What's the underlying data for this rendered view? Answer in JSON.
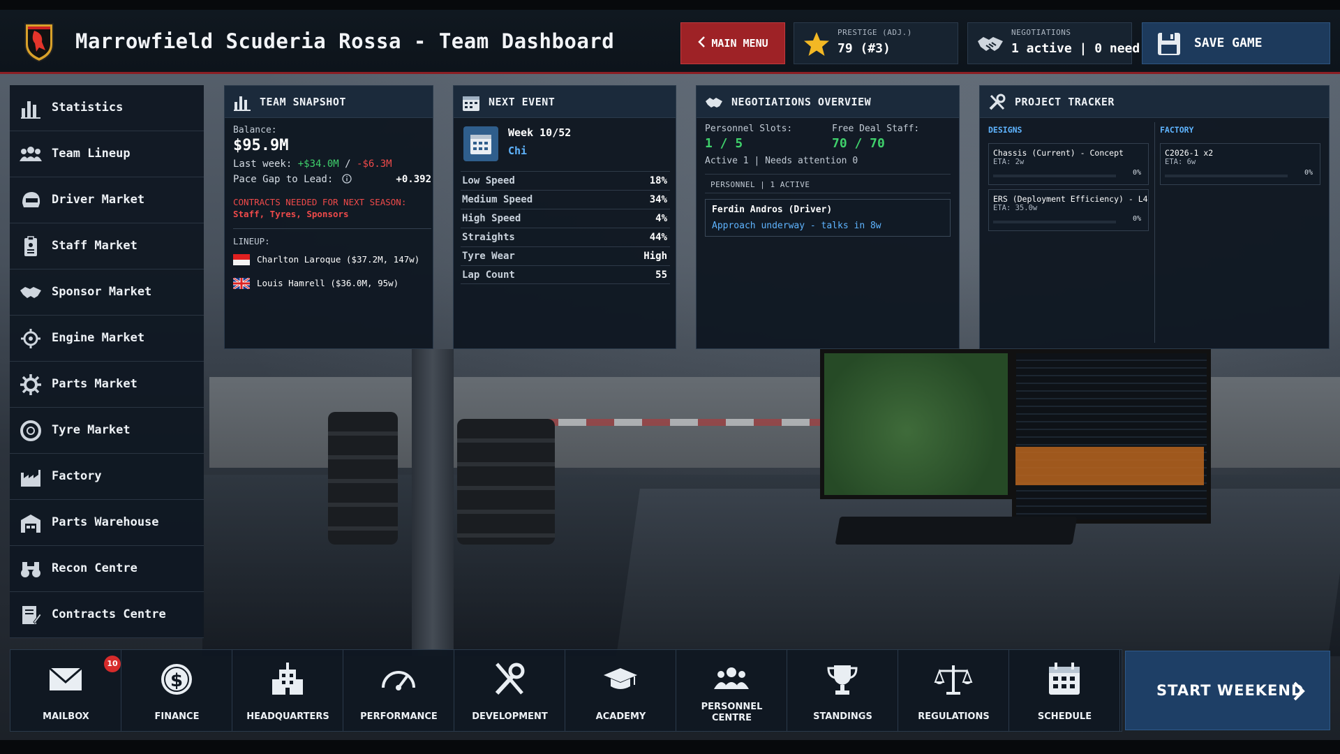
{
  "header": {
    "title": "Marrowfield Scuderia Rossa - Team Dashboard",
    "main_menu_label": "MAIN MENU",
    "prestige": {
      "label": "PRESTIGE (ADJ.)",
      "value": "79 (#3)"
    },
    "negotiations": {
      "label": "NEGOTIATIONS",
      "value": "1 active | 0 need"
    },
    "save_label": "SAVE GAME"
  },
  "sidebar": {
    "items": [
      {
        "label": "Statistics",
        "icon": "bar-chart-icon"
      },
      {
        "label": "Team Lineup",
        "icon": "people-icon"
      },
      {
        "label": "Driver Market",
        "icon": "helmet-icon"
      },
      {
        "label": "Staff Market",
        "icon": "clipboard-icon"
      },
      {
        "label": "Sponsor Market",
        "icon": "handshake-icon"
      },
      {
        "label": "Engine Market",
        "icon": "engine-icon"
      },
      {
        "label": "Parts Market",
        "icon": "gear-icon"
      },
      {
        "label": "Tyre Market",
        "icon": "tyre-icon"
      },
      {
        "label": "Factory",
        "icon": "factory-icon"
      },
      {
        "label": "Parts Warehouse",
        "icon": "warehouse-icon"
      },
      {
        "label": "Recon Centre",
        "icon": "binoculars-icon"
      },
      {
        "label": "Contracts Centre",
        "icon": "contract-icon"
      }
    ]
  },
  "team_snapshot": {
    "title": "TEAM SNAPSHOT",
    "balance_label": "Balance:",
    "balance": "$95.9M",
    "last_week_label": "Last week: ",
    "last_week_gain": "+$34.0M",
    "separator": " / ",
    "last_week_loss": "-$6.3M",
    "pace_gap_label": "Pace Gap to Lead:",
    "pace_gap_value": "+0.392",
    "contracts_warning_line1": "CONTRACTS NEEDED FOR NEXT SEASON:",
    "contracts_warning_line2": "Staff, Tyres, Sponsors",
    "lineup_label": "LINEUP:",
    "lineup": [
      {
        "text": "Charlton Laroque  ($37.2M, 147w)",
        "flag": "indonesia"
      },
      {
        "text": "Louis Hamrell  ($36.0M, 95w)",
        "flag": "uk"
      }
    ]
  },
  "next_event": {
    "title": "NEXT EVENT",
    "week": "Week 10/52",
    "location": "Chi",
    "rows": [
      {
        "label": "Low Speed",
        "value": "18%"
      },
      {
        "label": "Medium Speed",
        "value": "34%"
      },
      {
        "label": "High Speed",
        "value": "4%"
      },
      {
        "label": "Straights",
        "value": "44%"
      },
      {
        "label": "Tyre Wear",
        "value": "High"
      },
      {
        "label": "Lap Count",
        "value": "55"
      }
    ]
  },
  "negotiations_overview": {
    "title": "NEGOTIATIONS OVERVIEW",
    "personnel_slots_label": "Personnel Slots:",
    "personnel_slots_value": "1 / 5",
    "free_deal_label": "Free Deal Staff:",
    "free_deal_value": "70 / 70",
    "status_line": "Active 1  |  Needs attention 0",
    "tab_line": "PERSONNEL  |  1 ACTIVE",
    "card_name": "Ferdin Andros (Driver)",
    "card_status": "Approach underway - talks in 8w"
  },
  "project_tracker": {
    "title": "PROJECT TRACKER",
    "designs_label": "DESIGNS",
    "factory_label": "FACTORY",
    "designs": [
      {
        "name": "Chassis (Current) - Concept",
        "eta": "ETA: 2w",
        "progress": "0%"
      },
      {
        "name": "ERS (Deployment Efficiency) - L4",
        "eta": "ETA: 35.0w",
        "progress": "0%"
      }
    ],
    "factory": [
      {
        "name": "C2026-1 x2",
        "eta": "ETA: 6w",
        "progress": "0%"
      }
    ]
  },
  "dock": {
    "items": [
      {
        "label": "MAILBOX",
        "icon": "envelope-icon",
        "badge": "10"
      },
      {
        "label": "FINANCE",
        "icon": "dollar-coin-icon"
      },
      {
        "label": "HEADQUARTERS",
        "icon": "building-icon"
      },
      {
        "label": "PERFORMANCE",
        "icon": "speedometer-icon"
      },
      {
        "label": "DEVELOPMENT",
        "icon": "tools-icon"
      },
      {
        "label": "ACADEMY",
        "icon": "graduation-cap-icon"
      },
      {
        "label": "PERSONNEL",
        "label2": "CENTRE",
        "icon": "people-icon"
      },
      {
        "label": "STANDINGS",
        "icon": "trophy-icon"
      },
      {
        "label": "REGULATIONS",
        "icon": "scales-icon"
      },
      {
        "label": "SCHEDULE",
        "icon": "calendar-icon"
      }
    ],
    "start_label": "START WEEKEND"
  },
  "colors": {
    "accent_red": "#9e2226",
    "accent_blue": "#1e3f66",
    "positive": "#3fd06b",
    "negative": "#ef4a4a",
    "link": "#5fb4ff"
  }
}
